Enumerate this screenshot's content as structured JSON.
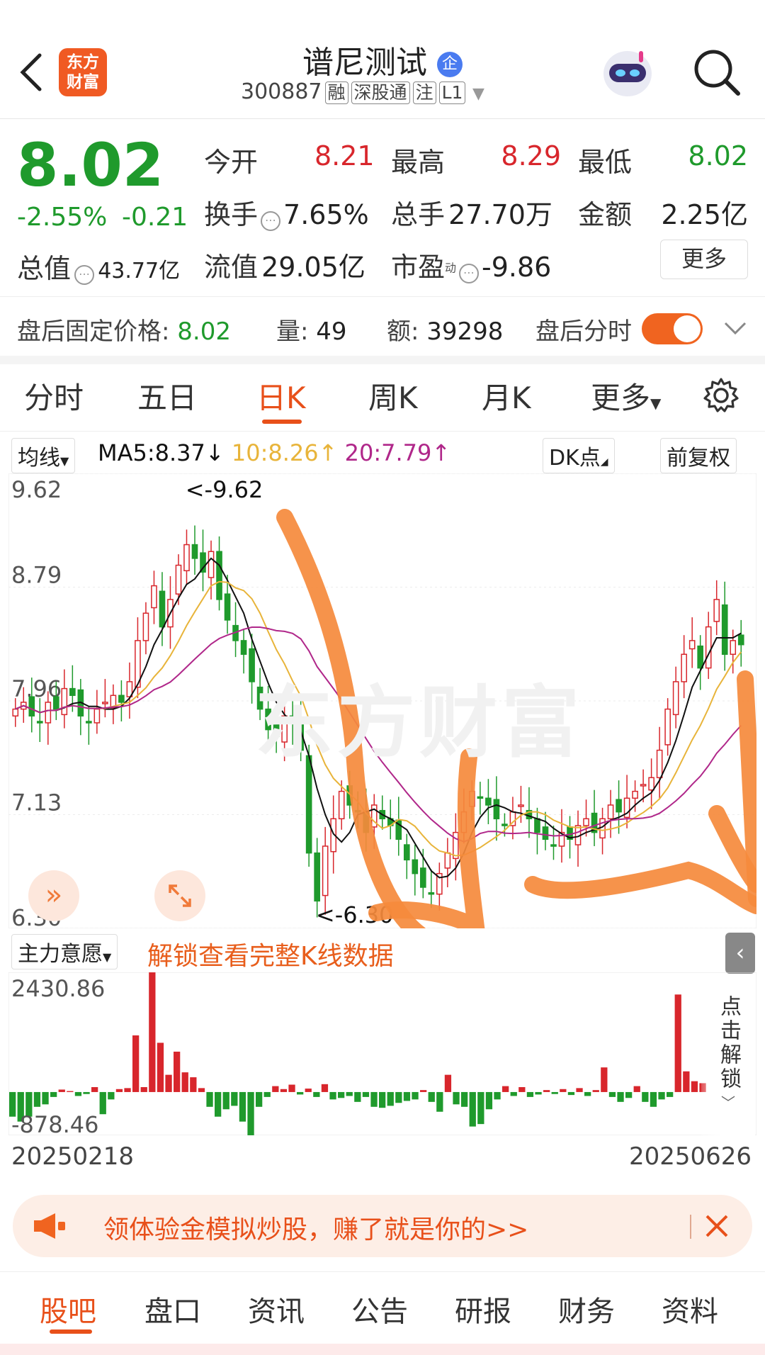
{
  "header": {
    "title": "谱尼测试",
    "title_badge": "企",
    "code": "300887",
    "tags": [
      "融",
      "深股通",
      "注",
      "L1"
    ],
    "logo_line1": "东方",
    "logo_line2": "财富"
  },
  "quote": {
    "price": "8.02",
    "change_pct": "-2.55%",
    "change_abs": "-0.21",
    "open_label": "今开",
    "open": "8.21",
    "high_label": "最高",
    "high": "8.29",
    "low_label": "最低",
    "low": "8.02",
    "turnover_label": "换手",
    "turnover": "7.65%",
    "volume_label": "总手",
    "volume": "27.70万",
    "amount_label": "金额",
    "amount": "2.25亿",
    "mktcap_label": "总值",
    "mktcap": "43.77亿",
    "float_label": "流值",
    "float": "29.05亿",
    "pe_label": "市盈",
    "pe_sup": "动",
    "pe": "-9.86",
    "more_label": "更多"
  },
  "after_hours": {
    "price_label": "盘后固定价格:",
    "price": "8.02",
    "vol_label": "量:",
    "vol": "49",
    "amt_label": "额:",
    "amt": "39298",
    "toggle_label": "盘后分时",
    "toggle_on": true
  },
  "tabs": [
    {
      "label": "分时",
      "active": false
    },
    {
      "label": "五日",
      "active": false
    },
    {
      "label": "日K",
      "active": true
    },
    {
      "label": "周K",
      "active": false
    },
    {
      "label": "月K",
      "active": false
    },
    {
      "label": "更多",
      "active": false
    }
  ],
  "ma_bar": {
    "selector": "均线",
    "ma5": "MA5:8.37",
    "ma5_arrow": "↓",
    "ma10": "10:8.26",
    "ma10_arrow": "↑",
    "ma20": "20:7.79",
    "ma20_arrow": "↑",
    "dk_label": "DK点",
    "adjust_label": "前复权"
  },
  "colors": {
    "up": "#d8262c",
    "down": "#1f9a2c",
    "accent": "#e85e1c",
    "ma5": "#111111",
    "ma10": "#e8b43a",
    "ma20": "#b0278a"
  },
  "chart_data": [
    {
      "type": "candlestick",
      "y_ticks": [
        "9.62",
        "8.79",
        "7.96",
        "7.13",
        "6.30"
      ],
      "ylim": [
        6.3,
        9.62
      ],
      "annotations": {
        "high": "<-9.62",
        "low": "<-6.30"
      },
      "ma5_last": 8.37,
      "ma10_last": 8.26,
      "ma20_last": 7.79,
      "closes": [
        7.9,
        7.95,
        7.85,
        7.8,
        7.95,
        7.9,
        8.05,
        8.0,
        7.85,
        7.8,
        7.9,
        7.95,
        8.0,
        7.95,
        8.1,
        8.4,
        8.6,
        8.8,
        8.5,
        8.7,
        8.95,
        9.1,
        9.0,
        8.9,
        9.05,
        8.7,
        8.55,
        8.4,
        8.3,
        8.1,
        7.9,
        7.75,
        7.7,
        7.85,
        7.8,
        7.6,
        6.85,
        6.5,
        6.9,
        7.1,
        7.3,
        7.2,
        7.15,
        7.0,
        7.2,
        7.1,
        7.05,
        6.95,
        6.8,
        6.7,
        6.6,
        6.55,
        6.7,
        6.85,
        7.0,
        7.15,
        7.3,
        7.25,
        7.2,
        7.1,
        7.05,
        7.15,
        7.2,
        7.1,
        7.0,
        6.95,
        6.9,
        7.0,
        6.95,
        7.05,
        7.1,
        7.0,
        7.1,
        7.2,
        7.15,
        7.25,
        7.3,
        7.35,
        7.4,
        7.6,
        7.9,
        8.1,
        8.3,
        8.4,
        8.2,
        8.5,
        8.7,
        8.3,
        8.4,
        8.37
      ]
    },
    {
      "type": "bar",
      "title": "主力意愿",
      "y_ticks": [
        "2430.86",
        "-878.46"
      ],
      "ylim": [
        -878.46,
        2430.86
      ],
      "x_start": "20250218",
      "x_end": "20250626",
      "values": [
        -500,
        -600,
        -500,
        -300,
        -250,
        -100,
        50,
        20,
        -80,
        -40,
        100,
        -450,
        -150,
        60,
        80,
        1150,
        100,
        2430,
        1000,
        350,
        820,
        400,
        300,
        80,
        -300,
        -500,
        -350,
        -280,
        -600,
        -878,
        -300,
        -100,
        120,
        60,
        150,
        -50,
        70,
        -100,
        160,
        -150,
        -120,
        -80,
        -200,
        -100,
        -300,
        -320,
        -280,
        -220,
        -180,
        -150,
        40,
        -200,
        -400,
        350,
        -250,
        -300,
        -700,
        -650,
        -350,
        -150,
        120,
        -80,
        100,
        -100,
        -50,
        40,
        -40,
        60,
        -60,
        80,
        -80,
        40,
        500,
        -100,
        -200,
        -120,
        120,
        -200,
        -300,
        -150,
        -100,
        1980,
        420,
        220,
        180
      ]
    }
  ],
  "vol_panel": {
    "selector": "主力意愿",
    "unlock_text": "解锁查看完整K线数据",
    "side_unlock": "点击解锁"
  },
  "banner": {
    "text": "领体验金模拟炒股，赚了就是你的>>"
  },
  "bottom_nav": [
    {
      "label": "股吧",
      "active": true
    },
    {
      "label": "盘口",
      "active": false
    },
    {
      "label": "资讯",
      "active": false
    },
    {
      "label": "公告",
      "active": false
    },
    {
      "label": "研报",
      "active": false
    },
    {
      "label": "财务",
      "active": false
    },
    {
      "label": "资料",
      "active": false
    }
  ]
}
